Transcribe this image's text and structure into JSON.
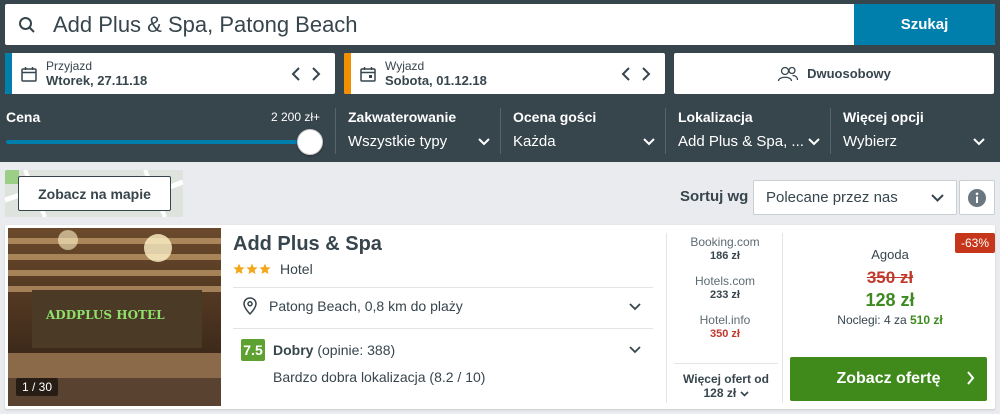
{
  "search": {
    "query": "Add Plus & Spa, Patong Beach",
    "button_label": "Szukaj"
  },
  "checkin": {
    "label": "Przyjazd",
    "value": "Wtorek, 27.11.18",
    "color": "#007fad"
  },
  "checkout": {
    "label": "Wyjazd",
    "value": "Sobota, 01.12.18",
    "color": "#f48f00"
  },
  "room": {
    "label": "Dwuosobowy"
  },
  "filters": {
    "price": {
      "label": "Cena",
      "max_value": "2 200 zł+",
      "slider_fraction": 1.0
    },
    "accommodation": {
      "label": "Zakwaterowanie",
      "value": "Wszystkie typy"
    },
    "rating": {
      "label": "Ocena gości",
      "value": "Każda"
    },
    "location": {
      "label": "Lokalizacja",
      "value": "Add Plus & Spa, ..."
    },
    "more": {
      "label": "Więcej opcji",
      "value": "Wybierz"
    }
  },
  "map": {
    "button_label": "Zobacz na mapie"
  },
  "sort": {
    "label": "Sortuj wg",
    "value": "Polecane przez nas"
  },
  "result": {
    "name": "Add Plus & Spa",
    "stars": 3,
    "type": "Hotel",
    "photo_counter": "1 / 30",
    "photo_sign": "ADDPLUS HOTEL",
    "location": "Patong Beach, 0,8 km do plaży",
    "rating_score": "7.5",
    "rating_word": "Dobry",
    "rating_count": "(opinie: 388)",
    "rating_sub": "Bardzo dobra lokalizacja (8.2 / 10)",
    "other_offers": [
      {
        "site": "Booking.com",
        "price": "186 zł",
        "highlight": false
      },
      {
        "site": "Hotels.com",
        "price": "233 zł",
        "highlight": false
      },
      {
        "site": "Hotel.info",
        "price": "350 zł",
        "highlight": true
      }
    ],
    "more_offers_label": "Więcej ofert od",
    "more_offers_price": "128 zł",
    "discount": "-63%",
    "best_site": "Agoda",
    "old_price": "350 zł",
    "new_price": "128 zł",
    "nights_label": "Noclegi: 4 za",
    "nights_total": "510 zł",
    "deal_button": "Zobacz ofertę"
  }
}
